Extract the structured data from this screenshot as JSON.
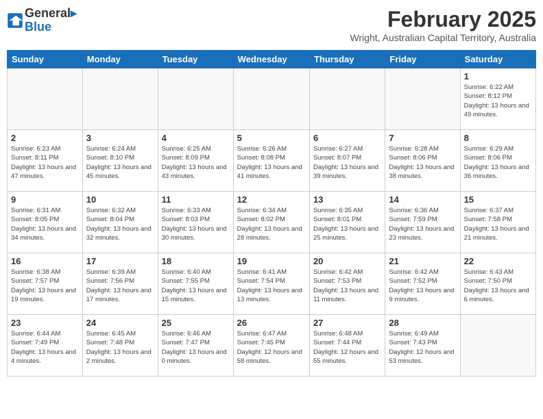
{
  "logo": {
    "line1": "General",
    "line2": "Blue"
  },
  "title": "February 2025",
  "location": "Wright, Australian Capital Territory, Australia",
  "days_of_week": [
    "Sunday",
    "Monday",
    "Tuesday",
    "Wednesday",
    "Thursday",
    "Friday",
    "Saturday"
  ],
  "weeks": [
    [
      {
        "day": "",
        "info": ""
      },
      {
        "day": "",
        "info": ""
      },
      {
        "day": "",
        "info": ""
      },
      {
        "day": "",
        "info": ""
      },
      {
        "day": "",
        "info": ""
      },
      {
        "day": "",
        "info": ""
      },
      {
        "day": "1",
        "info": "Sunrise: 6:22 AM\nSunset: 8:12 PM\nDaylight: 13 hours\nand 49 minutes."
      }
    ],
    [
      {
        "day": "2",
        "info": "Sunrise: 6:23 AM\nSunset: 8:11 PM\nDaylight: 13 hours\nand 47 minutes."
      },
      {
        "day": "3",
        "info": "Sunrise: 6:24 AM\nSunset: 8:10 PM\nDaylight: 13 hours\nand 45 minutes."
      },
      {
        "day": "4",
        "info": "Sunrise: 6:25 AM\nSunset: 8:09 PM\nDaylight: 13 hours\nand 43 minutes."
      },
      {
        "day": "5",
        "info": "Sunrise: 6:26 AM\nSunset: 8:08 PM\nDaylight: 13 hours\nand 41 minutes."
      },
      {
        "day": "6",
        "info": "Sunrise: 6:27 AM\nSunset: 8:07 PM\nDaylight: 13 hours\nand 39 minutes."
      },
      {
        "day": "7",
        "info": "Sunrise: 6:28 AM\nSunset: 8:06 PM\nDaylight: 13 hours\nand 38 minutes."
      },
      {
        "day": "8",
        "info": "Sunrise: 6:29 AM\nSunset: 8:06 PM\nDaylight: 13 hours\nand 36 minutes."
      }
    ],
    [
      {
        "day": "9",
        "info": "Sunrise: 6:31 AM\nSunset: 8:05 PM\nDaylight: 13 hours\nand 34 minutes."
      },
      {
        "day": "10",
        "info": "Sunrise: 6:32 AM\nSunset: 8:04 PM\nDaylight: 13 hours\nand 32 minutes."
      },
      {
        "day": "11",
        "info": "Sunrise: 6:33 AM\nSunset: 8:03 PM\nDaylight: 13 hours\nand 30 minutes."
      },
      {
        "day": "12",
        "info": "Sunrise: 6:34 AM\nSunset: 8:02 PM\nDaylight: 13 hours\nand 28 minutes."
      },
      {
        "day": "13",
        "info": "Sunrise: 6:35 AM\nSunset: 8:01 PM\nDaylight: 13 hours\nand 25 minutes."
      },
      {
        "day": "14",
        "info": "Sunrise: 6:36 AM\nSunset: 7:59 PM\nDaylight: 13 hours\nand 23 minutes."
      },
      {
        "day": "15",
        "info": "Sunrise: 6:37 AM\nSunset: 7:58 PM\nDaylight: 13 hours\nand 21 minutes."
      }
    ],
    [
      {
        "day": "16",
        "info": "Sunrise: 6:38 AM\nSunset: 7:57 PM\nDaylight: 13 hours\nand 19 minutes."
      },
      {
        "day": "17",
        "info": "Sunrise: 6:39 AM\nSunset: 7:56 PM\nDaylight: 13 hours\nand 17 minutes."
      },
      {
        "day": "18",
        "info": "Sunrise: 6:40 AM\nSunset: 7:55 PM\nDaylight: 13 hours\nand 15 minutes."
      },
      {
        "day": "19",
        "info": "Sunrise: 6:41 AM\nSunset: 7:54 PM\nDaylight: 13 hours\nand 13 minutes."
      },
      {
        "day": "20",
        "info": "Sunrise: 6:42 AM\nSunset: 7:53 PM\nDaylight: 13 hours\nand 11 minutes."
      },
      {
        "day": "21",
        "info": "Sunrise: 6:42 AM\nSunset: 7:52 PM\nDaylight: 13 hours\nand 9 minutes."
      },
      {
        "day": "22",
        "info": "Sunrise: 6:43 AM\nSunset: 7:50 PM\nDaylight: 13 hours\nand 6 minutes."
      }
    ],
    [
      {
        "day": "23",
        "info": "Sunrise: 6:44 AM\nSunset: 7:49 PM\nDaylight: 13 hours\nand 4 minutes."
      },
      {
        "day": "24",
        "info": "Sunrise: 6:45 AM\nSunset: 7:48 PM\nDaylight: 13 hours\nand 2 minutes."
      },
      {
        "day": "25",
        "info": "Sunrise: 6:46 AM\nSunset: 7:47 PM\nDaylight: 13 hours\nand 0 minutes."
      },
      {
        "day": "26",
        "info": "Sunrise: 6:47 AM\nSunset: 7:45 PM\nDaylight: 12 hours\nand 58 minutes."
      },
      {
        "day": "27",
        "info": "Sunrise: 6:48 AM\nSunset: 7:44 PM\nDaylight: 12 hours\nand 55 minutes."
      },
      {
        "day": "28",
        "info": "Sunrise: 6:49 AM\nSunset: 7:43 PM\nDaylight: 12 hours\nand 53 minutes."
      },
      {
        "day": "",
        "info": ""
      }
    ]
  ]
}
